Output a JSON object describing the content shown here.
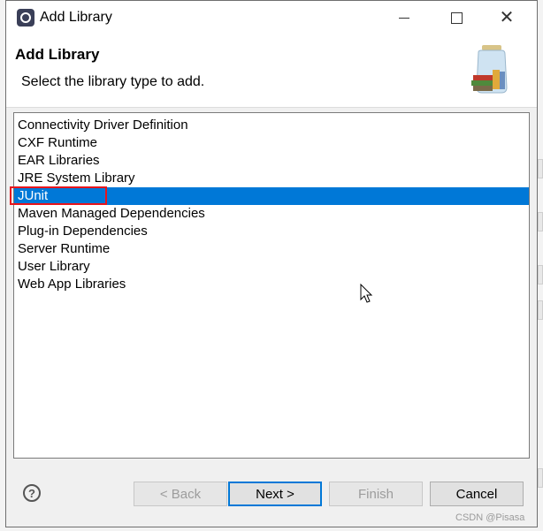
{
  "window": {
    "title": "Add Library"
  },
  "header": {
    "title": "Add Library",
    "subtitle": "Select the library type to add."
  },
  "library_list": {
    "items": [
      {
        "label": "Connectivity Driver Definition",
        "selected": false
      },
      {
        "label": "CXF Runtime",
        "selected": false
      },
      {
        "label": "EAR Libraries",
        "selected": false
      },
      {
        "label": "JRE System Library",
        "selected": false
      },
      {
        "label": "JUnit",
        "selected": true
      },
      {
        "label": "Maven Managed Dependencies",
        "selected": false
      },
      {
        "label": "Plug-in Dependencies",
        "selected": false
      },
      {
        "label": "Server Runtime",
        "selected": false
      },
      {
        "label": "User Library",
        "selected": false
      },
      {
        "label": "Web App Libraries",
        "selected": false
      }
    ]
  },
  "buttons": {
    "back": "< Back",
    "next": "Next >",
    "finish": "Finish",
    "cancel": "Cancel"
  },
  "help": {
    "glyph": "?"
  },
  "watermark": "CSDN @Pisasa",
  "colors": {
    "selection": "#0078d7",
    "highlight_box": "#e8141b",
    "dialog_bg": "#f0f0f0"
  }
}
